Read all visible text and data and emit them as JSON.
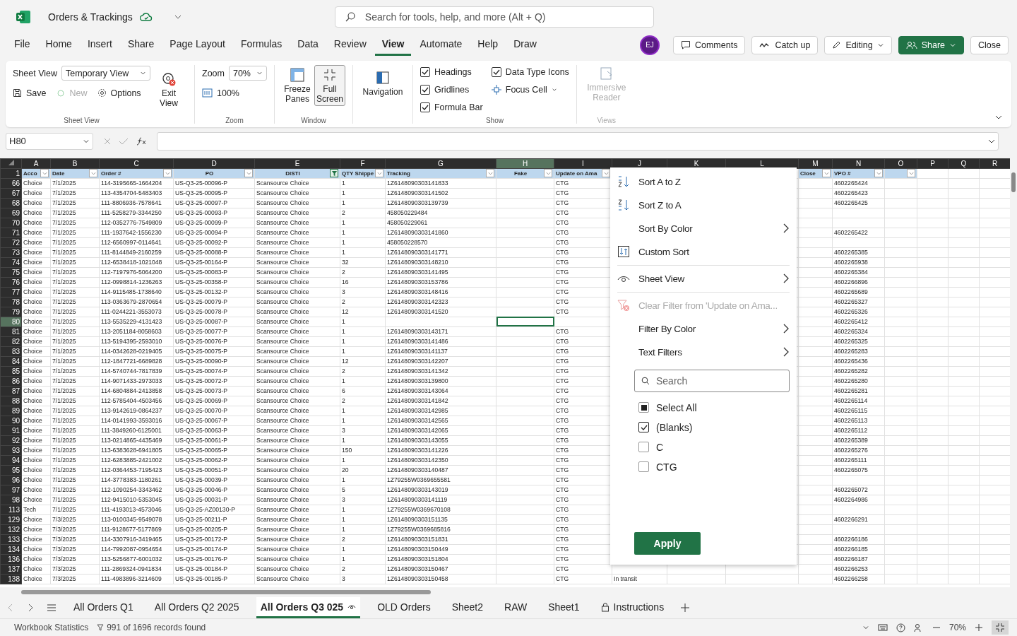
{
  "window": {
    "title": "Orders & Trackings",
    "search_placeholder": "Search for tools, help, and more (Alt + Q)"
  },
  "menu_tabs": [
    {
      "label": "File",
      "selected": false
    },
    {
      "label": "Home",
      "selected": false
    },
    {
      "label": "Insert",
      "selected": false
    },
    {
      "label": "Share",
      "selected": false
    },
    {
      "label": "Page Layout",
      "selected": false
    },
    {
      "label": "Formulas",
      "selected": false
    },
    {
      "label": "Data",
      "selected": false
    },
    {
      "label": "Review",
      "selected": false
    },
    {
      "label": "View",
      "selected": true
    },
    {
      "label": "Automate",
      "selected": false
    },
    {
      "label": "Help",
      "selected": false
    },
    {
      "label": "Draw",
      "selected": false
    }
  ],
  "account": {
    "initials": "EJ",
    "comments": "Comments",
    "catch_up": "Catch up",
    "editing": "Editing",
    "share": "Share",
    "close": "Close"
  },
  "sheet_view": {
    "label": "Sheet View",
    "view": "Temporary View",
    "save": "Save",
    "new": {
      "label": "New",
      "disabled": true
    },
    "options": "Options",
    "exit": "Exit View",
    "group": "Sheet View"
  },
  "zoom_group": {
    "label": "Zoom",
    "value": "70%",
    "reset": "100%",
    "group": "Zoom"
  },
  "window_group": {
    "freeze": "Freeze Panes",
    "full_screen": {
      "label": "Full Screen",
      "selected": true
    },
    "group": "Window"
  },
  "navigation": "Navigation",
  "show": {
    "options": [
      {
        "label": "Headings",
        "checked": true
      },
      {
        "label": "Gridlines",
        "checked": true
      },
      {
        "label": "Formula Bar",
        "checked": true
      },
      {
        "label": "Data Type Icons",
        "checked": true
      }
    ],
    "focus_cell": "Focus Cell",
    "group": "Show"
  },
  "views": {
    "immersive": {
      "label": "Immersive Reader",
      "disabled": true
    },
    "group": "Views"
  },
  "formula_bar": {
    "name_box": "H80"
  },
  "columns": [
    {
      "letter": "A",
      "header": "Acco",
      "filter_button": true,
      "filtered": false,
      "selected": false
    },
    {
      "letter": "B",
      "header": "Date",
      "filter_button": true,
      "filtered": false,
      "selected": false
    },
    {
      "letter": "C",
      "header": "Order #",
      "filter_button": true,
      "filtered": false,
      "selected": false
    },
    {
      "letter": "D",
      "header": "PO",
      "filter_button": true,
      "filtered": false,
      "selected": false
    },
    {
      "letter": "E",
      "header": "DISTI",
      "filter_button": true,
      "filtered": true,
      "selected": false
    },
    {
      "letter": "F",
      "header": "QTY Shippe",
      "filter_button": true,
      "filtered": false,
      "selected": false
    },
    {
      "letter": "G",
      "header": "Tracking",
      "filter_button": true,
      "filtered": false,
      "selected": false
    },
    {
      "letter": "H",
      "header": "Fake",
      "filter_button": true,
      "filtered": false,
      "selected": true
    },
    {
      "letter": "I",
      "header": "Update on Ama",
      "filter_button": true,
      "filtered": false,
      "selected": false
    },
    {
      "letter": "J",
      "selected": false
    },
    {
      "letter": "K",
      "selected": false
    },
    {
      "letter": "L",
      "selected": false
    },
    {
      "letter": "M",
      "header": "Close",
      "filter_button": true,
      "filtered": false,
      "selected": false
    },
    {
      "letter": "N",
      "header": "VPO #",
      "filter_button": true,
      "filtered": false,
      "selected": false
    },
    {
      "letter": "O",
      "filter_button": true,
      "filtered": false,
      "selected": false
    },
    {
      "letter": "P",
      "selected": false
    },
    {
      "letter": "Q",
      "selected": false
    },
    {
      "letter": "R",
      "selected": false
    }
  ],
  "header_row": "1",
  "rows": [
    {
      "row": "66",
      "selected": false,
      "account": "Choice",
      "date": "7/1/2025",
      "order": "114-3195665-1664204",
      "po": "US-Q3-25-00096-P",
      "disti": "Scansource Choice",
      "qty": "1",
      "tracking": "1Z6148090303141833",
      "update": "CTG",
      "vpo": "4602265424"
    },
    {
      "row": "67",
      "selected": false,
      "account": "Choice",
      "date": "7/1/2025",
      "order": "113-4354704-5483403",
      "po": "US-Q3-25-00095-P",
      "disti": "Scansource Choice",
      "qty": "1",
      "tracking": "1Z6148090303141502",
      "update": "CTG",
      "vpo": "4602265423"
    },
    {
      "row": "68",
      "selected": false,
      "account": "Choice",
      "date": "7/1/2025",
      "order": "111-8806936-7578641",
      "po": "US-Q3-25-00097-P",
      "disti": "Scansource Choice",
      "qty": "1",
      "tracking": "1Z6148090303139739",
      "update": "CTG",
      "vpo": "4602265425"
    },
    {
      "row": "69",
      "selected": false,
      "account": "Choice",
      "date": "7/1/2025",
      "order": "111-5258279-3344250",
      "po": "US-Q3-25-00093-P",
      "disti": "Scansource Choice",
      "qty": "2",
      "tracking": "458050229484",
      "update": "CTG"
    },
    {
      "row": "70",
      "selected": false,
      "account": "Choice",
      "date": "7/1/2025",
      "order": "112-0352776-7549809",
      "po": "US-Q3-25-00099-P",
      "disti": "Scansource Choice",
      "qty": "1",
      "tracking": "458050229061",
      "update": "CTG"
    },
    {
      "row": "71",
      "selected": false,
      "account": "Choice",
      "date": "7/1/2025",
      "order": "111-1937642-1556230",
      "po": "US-Q3-25-00094-P",
      "disti": "Scansource Choice",
      "qty": "1",
      "tracking": "1Z6148090303141860",
      "update": "CTG",
      "vpo": "4602265422"
    },
    {
      "row": "72",
      "selected": false,
      "account": "Choice",
      "date": "7/1/2025",
      "order": "112-6560997-0114641",
      "po": "US-Q3-25-00092-P",
      "disti": "Scansource Choice",
      "qty": "1",
      "tracking": "458050228570",
      "update": "CTG"
    },
    {
      "row": "73",
      "selected": false,
      "account": "Choice",
      "date": "7/1/2025",
      "order": "111-8144849-2160259",
      "po": "US-Q3-25-00088-P",
      "disti": "Scansource Choice",
      "qty": "1",
      "tracking": "1Z6148090303141771",
      "update": "CTG",
      "vpo": "4602265385"
    },
    {
      "row": "74",
      "selected": false,
      "account": "Choice",
      "date": "7/1/2025",
      "order": "112-6538418-1021048",
      "po": "US-Q3-25-00164-P",
      "disti": "Scansource Choice",
      "qty": "32",
      "tracking": "1Z6148090303148210",
      "update": "CTG",
      "vpo": "4602265938"
    },
    {
      "row": "75",
      "selected": false,
      "account": "Choice",
      "date": "7/1/2025",
      "order": "112-7197976-5064200",
      "po": "US-Q3-25-00083-P",
      "disti": "Scansource Choice",
      "qty": "2",
      "tracking": "1Z6148090303141495",
      "update": "CTG",
      "vpo": "4602265384"
    },
    {
      "row": "76",
      "selected": false,
      "account": "Choice",
      "date": "7/1/2025",
      "order": "112-0998814-1236263",
      "po": "US-Q3-25-00358-P",
      "disti": "Scansource Choice",
      "qty": "16",
      "tracking": "1Z6148090303153786",
      "update": "CTG",
      "vpo": "4602266896"
    },
    {
      "row": "77",
      "selected": false,
      "account": "Choice",
      "date": "7/1/2025",
      "order": "114-9115485-1738640",
      "po": "US-Q3-25-00132-P",
      "disti": "Scansource Choice",
      "qty": "3",
      "tracking": "1Z6148090303148416",
      "update": "CTG",
      "vpo": "4602265689"
    },
    {
      "row": "78",
      "selected": false,
      "account": "Choice",
      "date": "7/1/2025",
      "order": "113-0363679-2870654",
      "po": "US-Q3-25-00079-P",
      "disti": "Scansource Choice",
      "qty": "2",
      "tracking": "1Z6148090303142323",
      "update": "CTG",
      "vpo": "4602265327"
    },
    {
      "row": "79",
      "selected": false,
      "account": "Choice",
      "date": "7/1/2025",
      "order": "111-0244221-3553073",
      "po": "US-Q3-25-00078-P",
      "disti": "Scansource Choice",
      "qty": "12",
      "tracking": "1Z6148090303141520",
      "update": "CTG",
      "vpo": "4602265326"
    },
    {
      "row": "80",
      "selected": true,
      "account": "Choice",
      "date": "7/1/2025",
      "order": "113-5535229-4131423",
      "po": "US-Q3-25-00087-P",
      "disti": "Scansource Choice",
      "qty": "1",
      "vpo": "4602265412"
    },
    {
      "row": "81",
      "selected": false,
      "account": "Choice",
      "date": "7/1/2025",
      "order": "113-2051184-8058603",
      "po": "US-Q3-25-00077-P",
      "disti": "Scansource Choice",
      "qty": "1",
      "tracking": "1Z6148090303143171",
      "update": "CTG",
      "vpo": "4602265324"
    },
    {
      "row": "82",
      "selected": false,
      "account": "Choice",
      "date": "7/1/2025",
      "order": "113-5194395-2593010",
      "po": "US-Q3-25-00076-P",
      "disti": "Scansource Choice",
      "qty": "1",
      "tracking": "1Z6148090303141486",
      "update": "CTG",
      "vpo": "4602265325"
    },
    {
      "row": "83",
      "selected": false,
      "account": "Choice",
      "date": "7/1/2025",
      "order": "114-0342628-0219405",
      "po": "US-Q3-25-00075-P",
      "disti": "Scansource Choice",
      "qty": "1",
      "tracking": "1Z6148090303141137",
      "update": "CTG",
      "vpo": "4602265283"
    },
    {
      "row": "84",
      "selected": false,
      "account": "Choice",
      "date": "7/1/2025",
      "order": "112-1847721-6689828",
      "po": "US-Q3-25-00090-P",
      "disti": "Scansource Choice",
      "qty": "12",
      "tracking": "1Z6148090303142207",
      "update": "CTG",
      "vpo": "4602265436"
    },
    {
      "row": "85",
      "selected": false,
      "account": "Choice",
      "date": "7/1/2025",
      "order": "114-5740744-7817839",
      "po": "US-Q3-25-00074-P",
      "disti": "Scansource Choice",
      "qty": "2",
      "tracking": "1Z6148090303141342",
      "update": "CTG",
      "vpo": "4602265282"
    },
    {
      "row": "86",
      "selected": false,
      "account": "Choice",
      "date": "7/1/2025",
      "order": "114-9071433-2973033",
      "po": "US-Q3-25-00072-P",
      "disti": "Scansource Choice",
      "qty": "1",
      "tracking": "1Z6148090303139800",
      "update": "CTG",
      "vpo": "4602265280"
    },
    {
      "row": "87",
      "selected": false,
      "account": "Choice",
      "date": "7/1/2025",
      "order": "114-6804884-2413858",
      "po": "US-Q3-25-00073-P",
      "disti": "Scansource Choice",
      "qty": "6",
      "tracking": "1Z6148090303143064",
      "update": "CTG",
      "vpo": "4602265281"
    },
    {
      "row": "88",
      "selected": false,
      "account": "Choice",
      "date": "7/1/2025",
      "order": "112-5785404-4503456",
      "po": "US-Q3-25-00069-P",
      "disti": "Scansource Choice",
      "qty": "2",
      "tracking": "1Z6148090303141842",
      "update": "CTG",
      "vpo": "4602265114"
    },
    {
      "row": "89",
      "selected": false,
      "account": "Choice",
      "date": "7/1/2025",
      "order": "113-9142619-0864237",
      "po": "US-Q3-25-00070-P",
      "disti": "Scansource Choice",
      "qty": "1",
      "tracking": "1Z6148090303142985",
      "update": "CTG",
      "vpo": "4602265115"
    },
    {
      "row": "90",
      "selected": false,
      "account": "Choice",
      "date": "7/1/2025",
      "order": "114-0141993-3593016",
      "po": "US-Q3-25-00067-P",
      "disti": "Scansource Choice",
      "qty": "1",
      "tracking": "1Z6148090303142565",
      "update": "CTG",
      "vpo": "4602265113"
    },
    {
      "row": "91",
      "selected": false,
      "account": "Choice",
      "date": "7/1/2025",
      "order": "111-3849260-6125001",
      "po": "US-Q3-25-00063-P",
      "disti": "Scansource Choice",
      "qty": "3",
      "tracking": "1Z6148090303142065",
      "update": "CTG",
      "vpo": "4602265112"
    },
    {
      "row": "92",
      "selected": false,
      "account": "Choice",
      "date": "7/1/2025",
      "order": "113-0214865-4435469",
      "po": "US-Q3-25-00061-P",
      "disti": "Scansource Choice",
      "qty": "1",
      "tracking": "1Z6148090303143055",
      "update": "CTG",
      "vpo": "4602265389"
    },
    {
      "row": "93",
      "selected": false,
      "account": "Choice",
      "date": "7/1/2025",
      "order": "113-6383628-6941805",
      "po": "US-Q3-25-00065-P",
      "disti": "Scansource Choice",
      "qty": "150",
      "tracking": "1Z6148090303141226",
      "update": "CTG",
      "vpo": "4602265276"
    },
    {
      "row": "94",
      "selected": false,
      "account": "Choice",
      "date": "7/1/2025",
      "order": "112-6283885-2421002",
      "po": "US-Q3-25-00062-P",
      "disti": "Scansource Choice",
      "qty": "1",
      "tracking": "1Z6148090303142350",
      "update": "CTG",
      "vpo": "4602265111"
    },
    {
      "row": "95",
      "selected": false,
      "account": "Choice",
      "date": "7/1/2025",
      "order": "112-0364453-7195423",
      "po": "US-Q3-25-00051-P",
      "disti": "Scansource Choice",
      "qty": "20",
      "tracking": "1Z6148090303140487",
      "update": "CTG",
      "vpo": "4602265075"
    },
    {
      "row": "96",
      "selected": false,
      "account": "Choice",
      "date": "7/1/2025",
      "order": "114-3778383-1180261",
      "po": "US-Q3-25-00039-P",
      "disti": "Scansource Choice",
      "qty": "1",
      "tracking": "1Z79255W0369655581",
      "update": "CTG"
    },
    {
      "row": "97",
      "selected": false,
      "account": "Choice",
      "date": "7/1/2025",
      "order": "112-1090254-3343462",
      "po": "US-Q3-25-00046-P",
      "disti": "Scansource Choice",
      "qty": "5",
      "tracking": "1Z6148090303143019",
      "update": "CTG",
      "vpo": "4602265072"
    },
    {
      "row": "98",
      "selected": false,
      "account": "Choice",
      "date": "7/1/2025",
      "order": "112-9415010-5353045",
      "po": "US-Q3-25-00031-P",
      "disti": "Scansource Choice",
      "qty": "3",
      "tracking": "1Z6148090303141119",
      "update": "CTG",
      "vpo": "4602264986"
    },
    {
      "row": "113",
      "selected": false,
      "account": "Tech",
      "date": "7/1/2025",
      "order": "111-4193013-4573046",
      "po": "US-Q3-25-AZ00130-P",
      "disti": "Scansource Choice",
      "qty": "1",
      "tracking": "1Z79255W0369670108",
      "update": "CTG"
    },
    {
      "row": "129",
      "selected": false,
      "account": "Choice",
      "date": "7/3/2025",
      "order": "113-0100345-9549078",
      "po": "US-Q3-25-00211-P",
      "disti": "Scansource Choice",
      "qty": "1",
      "tracking": "1Z6148090303151135",
      "update": "CTG",
      "vpo": "4602266291"
    },
    {
      "row": "132",
      "selected": false,
      "account": "Choice",
      "date": "7/3/2025",
      "order": "111-9128677-5177869",
      "po": "US-Q3-25-00205-P",
      "disti": "Scansource Choice",
      "qty": "1",
      "tracking": "1Z79255W0369685816",
      "update": "CTG"
    },
    {
      "row": "133",
      "selected": false,
      "account": "Choice",
      "date": "7/3/2025",
      "order": "114-3307916-3419465",
      "po": "US-Q3-25-00172-P",
      "disti": "Scansource Choice",
      "qty": "2",
      "tracking": "1Z6148090303151831",
      "update": "CTG",
      "vpo": "4602266186"
    },
    {
      "row": "134",
      "selected": false,
      "account": "Choice",
      "date": "7/3/2025",
      "order": "114-7992087-0954654",
      "po": "US-Q3-25-00174-P",
      "disti": "Scansource Choice",
      "qty": "1",
      "tracking": "1Z6148090303150449",
      "update": "CTG",
      "vpo": "4602266185"
    },
    {
      "row": "136",
      "selected": false,
      "account": "Choice",
      "date": "7/3/2025",
      "order": "113-5256877-6001032",
      "po": "US-Q3-25-00176-P",
      "disti": "Scansource Choice",
      "qty": "1",
      "tracking": "1Z6148090303151804",
      "update": "CTG",
      "vpo": "4602266187"
    },
    {
      "row": "137",
      "selected": false,
      "account": "Choice",
      "date": "7/3/2025",
      "order": "111-2869324-0941834",
      "po": "US-Q3-25-00184-P",
      "disti": "Scansource Choice",
      "qty": "2",
      "tracking": "1Z6148090303150467",
      "update": "CTG",
      "vpo": "4602266253"
    },
    {
      "row": "138",
      "selected": false,
      "account": "Choice",
      "date": "7/3/2025",
      "order": "111-4983896-3214609",
      "po": "US-Q3-25-00185-P",
      "disti": "Scansource Choice",
      "qty": "3",
      "tracking": "1Z6148090303150458",
      "update": "CTG",
      "status": "In transit",
      "vpo": "4602266258"
    }
  ],
  "filter_menu": {
    "groups": [
      [
        {
          "label": "Sort A to Z",
          "submenu": false,
          "disabled": false
        },
        {
          "label": "Sort Z to A",
          "submenu": false,
          "disabled": false
        },
        {
          "label": "Sort By Color",
          "submenu": true,
          "disabled": false
        },
        {
          "label": "Custom Sort",
          "submenu": false,
          "disabled": false
        }
      ],
      [
        {
          "label": "Sheet View",
          "submenu": true,
          "disabled": false
        }
      ],
      [
        {
          "label": "Clear Filter from 'Update on Ama...",
          "submenu": false,
          "disabled": true
        },
        {
          "label": "Filter By Color",
          "submenu": true,
          "disabled": false
        },
        {
          "label": "Text Filters",
          "submenu": true,
          "disabled": false
        }
      ]
    ],
    "search_placeholder": "Search",
    "values": [
      {
        "label": "Select All",
        "checked": false,
        "indeterminate": true
      },
      {
        "label": "(Blanks)",
        "checked": true,
        "indeterminate": false
      },
      {
        "label": "C",
        "checked": false,
        "indeterminate": false
      },
      {
        "label": "CTG",
        "checked": false,
        "indeterminate": false
      }
    ],
    "apply": "Apply"
  },
  "sheet_tabs": [
    {
      "label": "All Orders Q1",
      "selected": false,
      "locked": false,
      "view_icon": false
    },
    {
      "label": "All Orders Q2 2025",
      "selected": false,
      "locked": false,
      "view_icon": false
    },
    {
      "label": "All Orders Q3 025",
      "selected": true,
      "locked": false,
      "view_icon": true
    },
    {
      "label": "OLD Orders",
      "selected": false,
      "locked": false,
      "view_icon": false
    },
    {
      "label": "Sheet2",
      "selected": false,
      "locked": false,
      "view_icon": false
    },
    {
      "label": "RAW",
      "selected": false,
      "locked": false,
      "view_icon": false
    },
    {
      "label": "Sheet1",
      "selected": false,
      "locked": false,
      "view_icon": false
    },
    {
      "label": "Instructions",
      "selected": false,
      "locked": true,
      "view_icon": false
    }
  ],
  "status_bar": {
    "statistics": "Workbook Statistics",
    "records": "991 of 1696 records found",
    "zoom": "70%"
  }
}
